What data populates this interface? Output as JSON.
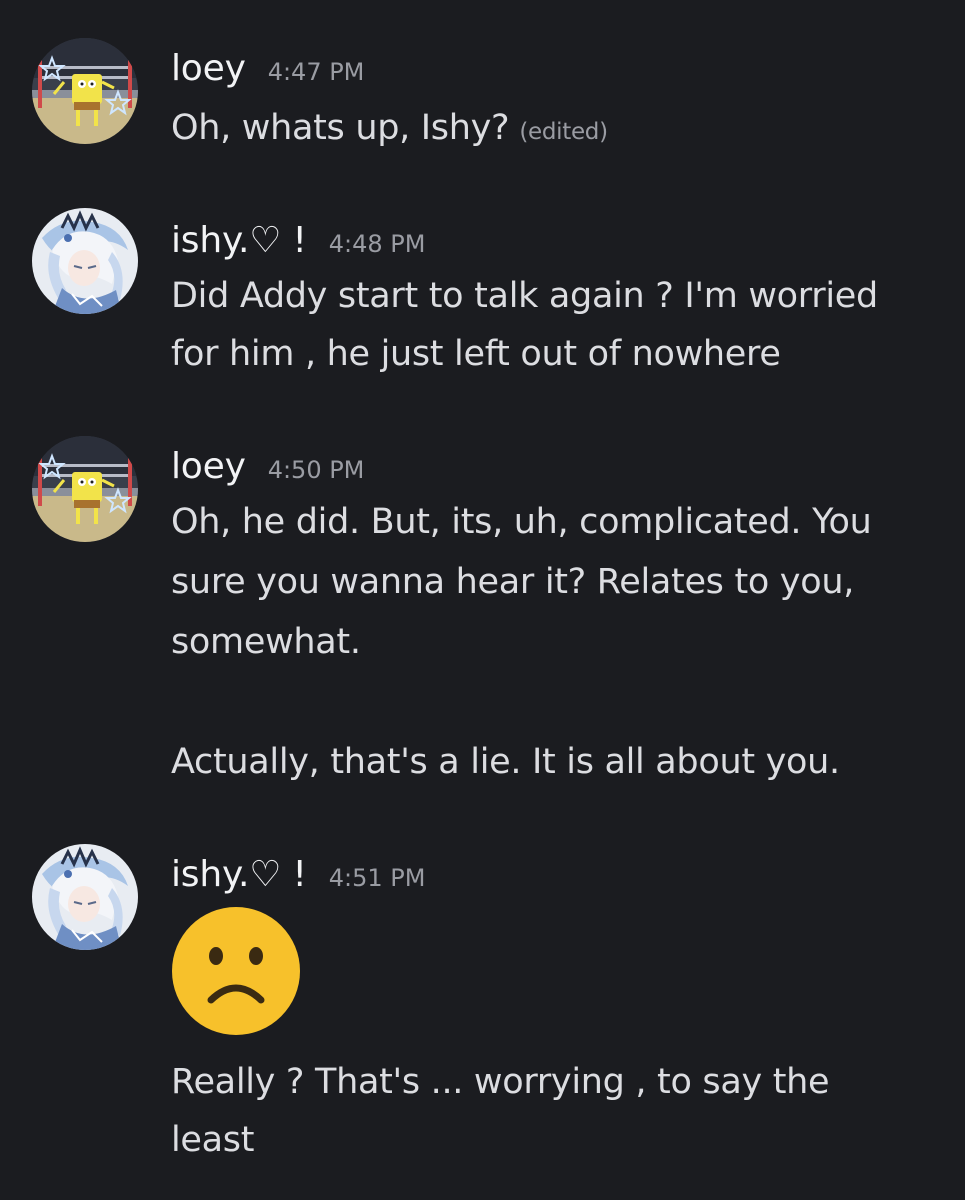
{
  "messages": [
    {
      "username": "loey",
      "timestamp": "4:47 PM",
      "lines": [
        "Oh, whats up, Ishy?"
      ],
      "edited_label": "(edited)",
      "avatar": "spongebob-avatar"
    },
    {
      "username": "ishy.♡ !",
      "timestamp": "4:48 PM",
      "lines": [
        "Did Addy start to talk again ? I'm worried",
        "for him , he just left out of nowhere"
      ],
      "avatar": "anime-character-avatar"
    },
    {
      "username": "loey",
      "timestamp": "4:50 PM",
      "lines": [
        "Oh, he did. But, its, uh, complicated. You",
        "sure you wanna hear it? Relates to you,",
        "somewhat.",
        "",
        "Actually, that's a lie. It is all about you."
      ],
      "avatar": "spongebob-avatar"
    },
    {
      "username": "ishy.♡ !",
      "timestamp": "4:51 PM",
      "emoji": "slightly-frowning-face-emoji",
      "lines": [
        "Really ? That's ... worrying , to say the",
        "least"
      ],
      "avatar": "anime-character-avatar"
    }
  ],
  "colors": {
    "background": "#1b1c20",
    "username": "#f2f3f5",
    "text": "#dcdde1",
    "muted": "#9a9ca3",
    "emoji_face": "#f7c12b"
  }
}
